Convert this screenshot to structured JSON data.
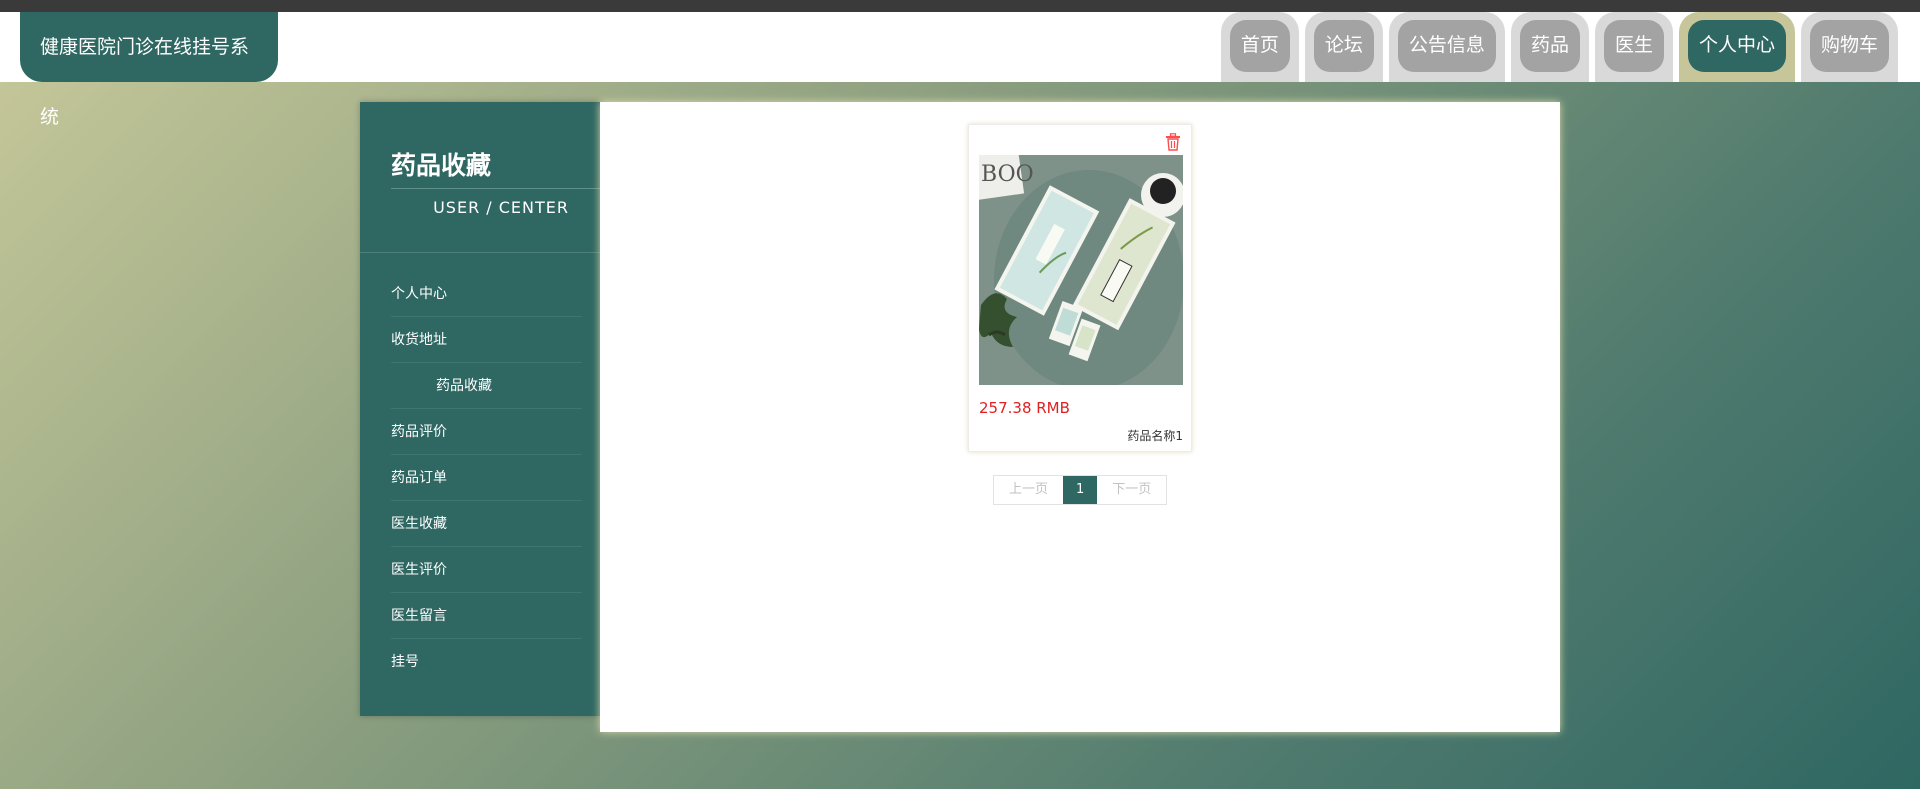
{
  "header": {
    "brand": "健康医院门诊在线挂号系统",
    "nav": [
      "首页",
      "论坛",
      "公告信息",
      "药品",
      "医生",
      "个人中心",
      "购物车"
    ],
    "active_nav": "个人中心"
  },
  "sidebar": {
    "title": "药品收藏",
    "subtitle": "USER / CENTER",
    "items": [
      "个人中心",
      "收货地址",
      "药品收藏",
      "药品评价",
      "药品订单",
      "医生收藏",
      "医生评价",
      "医生留言",
      "挂号"
    ],
    "active_item": "药品收藏"
  },
  "favorites": [
    {
      "price": "257.38 RMB",
      "name": "药品名称1"
    }
  ],
  "pagination": {
    "prev": "上一页",
    "current": "1",
    "next": "下一页"
  },
  "colors": {
    "primary": "#2f6762",
    "price": "#e02020",
    "tab_inactive": "#a3a3a3",
    "tab_active_border": "#c6c69a"
  },
  "icons": {
    "delete": "trash-icon"
  }
}
